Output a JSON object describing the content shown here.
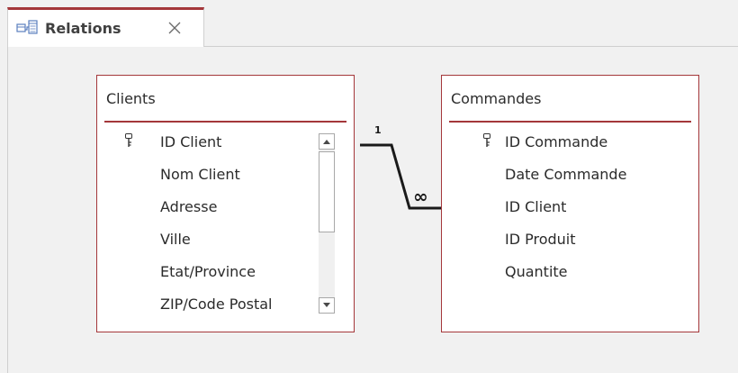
{
  "tab": {
    "title": "Relations",
    "icon": "relationships-icon",
    "close_icon": "close-icon"
  },
  "colors": {
    "accent": "#a4373a",
    "background": "#f1f1f1"
  },
  "tables": [
    {
      "title": "Clients",
      "fields": [
        {
          "name": "ID Client",
          "primary_key": true
        },
        {
          "name": "Nom Client",
          "primary_key": false
        },
        {
          "name": "Adresse",
          "primary_key": false
        },
        {
          "name": "Ville",
          "primary_key": false
        },
        {
          "name": "Etat/Province",
          "primary_key": false
        },
        {
          "name": "ZIP/Code Postal",
          "primary_key": false
        }
      ],
      "has_scrollbar": true
    },
    {
      "title": "Commandes",
      "fields": [
        {
          "name": "ID Commande",
          "primary_key": true
        },
        {
          "name": "Date Commande",
          "primary_key": false
        },
        {
          "name": "ID Client",
          "primary_key": false
        },
        {
          "name": "ID Produit",
          "primary_key": false
        },
        {
          "name": "Quantite",
          "primary_key": false
        }
      ],
      "has_scrollbar": false
    }
  ],
  "relationship": {
    "from_table": "Clients",
    "from_field": "ID Client",
    "to_table": "Commandes",
    "to_field": "ID Client",
    "one_label": "1",
    "many_label": "∞"
  }
}
